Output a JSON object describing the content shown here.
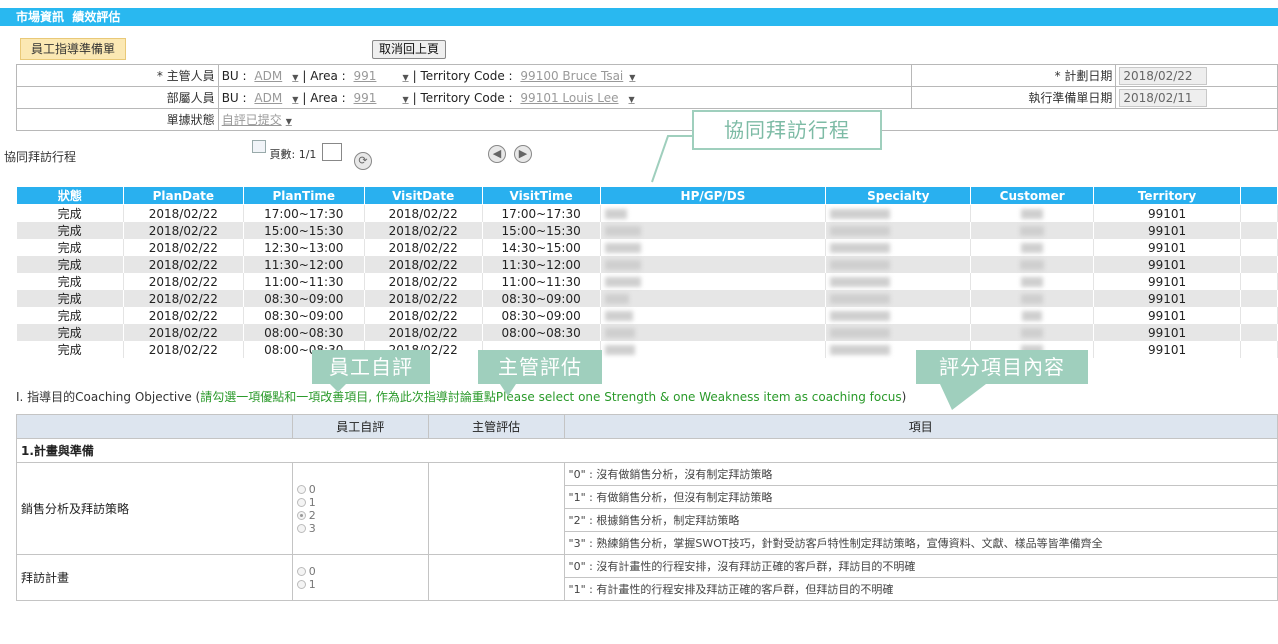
{
  "topbar": {
    "title": "市場資訊  績效評估"
  },
  "subtab": {
    "label": "員工指導準備單"
  },
  "back_button": {
    "label": "取消回上頁"
  },
  "form": {
    "rows": [
      {
        "label": "* 主管人員",
        "bu": "ADM",
        "area": "991",
        "territory": "99100 Bruce Tsai",
        "date_label": "* 計劃日期",
        "date": "2018/02/22"
      },
      {
        "label": "部屬人員",
        "bu": "ADM",
        "area": "991",
        "territory": "99101 Louis Lee",
        "date_label": "執行準備單日期",
        "date": "2018/02/11"
      }
    ],
    "bu_label": "BU :",
    "area_label": "Area :",
    "territory_label": "Territory Code :",
    "status_label": "單據狀態",
    "status_value": "自評已提交"
  },
  "visits_section": {
    "title": "協同拜訪行程",
    "pager_label": "頁數: 1/1"
  },
  "visits_table": {
    "headers": [
      "狀態",
      "PlanDate",
      "PlanTime",
      "VisitDate",
      "VisitTime",
      "HP/GP/DS",
      "Specialty",
      "Customer",
      "Territory"
    ],
    "rows": [
      {
        "status": "完成",
        "plan_date": "2018/02/22",
        "plan_time": "17:00~17:30",
        "visit_date": "2018/02/22",
        "visit_time": "17:00~17:30",
        "territory": "99101"
      },
      {
        "status": "完成",
        "plan_date": "2018/02/22",
        "plan_time": "15:00~15:30",
        "visit_date": "2018/02/22",
        "visit_time": "15:00~15:30",
        "territory": "99101"
      },
      {
        "status": "完成",
        "plan_date": "2018/02/22",
        "plan_time": "12:30~13:00",
        "visit_date": "2018/02/22",
        "visit_time": "14:30~15:00",
        "territory": "99101"
      },
      {
        "status": "完成",
        "plan_date": "2018/02/22",
        "plan_time": "11:30~12:00",
        "visit_date": "2018/02/22",
        "visit_time": "11:30~12:00",
        "territory": "99101"
      },
      {
        "status": "完成",
        "plan_date": "2018/02/22",
        "plan_time": "11:00~11:30",
        "visit_date": "2018/02/22",
        "visit_time": "11:00~11:30",
        "territory": "99101"
      },
      {
        "status": "完成",
        "plan_date": "2018/02/22",
        "plan_time": "08:30~09:00",
        "visit_date": "2018/02/22",
        "visit_time": "08:30~09:00",
        "territory": "99101"
      },
      {
        "status": "完成",
        "plan_date": "2018/02/22",
        "plan_time": "08:30~09:00",
        "visit_date": "2018/02/22",
        "visit_time": "08:30~09:00",
        "territory": "99101"
      },
      {
        "status": "完成",
        "plan_date": "2018/02/22",
        "plan_time": "08:00~08:30",
        "visit_date": "2018/02/22",
        "visit_time": "08:00~08:30",
        "territory": "99101"
      },
      {
        "status": "完成",
        "plan_date": "2018/02/22",
        "plan_time": "08:00~08:30",
        "visit_date": "2018/02/22",
        "visit_time": "",
        "territory": "99101"
      }
    ]
  },
  "objective": {
    "prefix": "I. 指導目的Coaching Objective (",
    "highlight": "請勾選一項優點和一項改善項目, 作為此次指導討論重點Please select one Strength & one Weakness item as coaching focus",
    "suffix": ")"
  },
  "score_table": {
    "headers": {
      "self": "員工自評",
      "manager": "主管評估",
      "item": "項目"
    },
    "category": "1.計畫與準備",
    "groups": [
      {
        "name": "銷售分析及拜訪策略",
        "options": [
          "0",
          "1",
          "2",
          "3"
        ],
        "selected": "2",
        "items": [
          "\"0\" : 沒有做銷售分析，沒有制定拜訪策略",
          "\"1\" : 有做銷售分析，但沒有制定拜訪策略",
          "\"2\" : 根據銷售分析，制定拜訪策略",
          "\"3\" : 熟練銷售分析，掌握SWOT技巧，針對受訪客戶特性制定拜訪策略，宣傳資料、文獻、樣品等皆準備齊全"
        ]
      },
      {
        "name": "拜訪計畫",
        "options": [
          "0",
          "1"
        ],
        "selected": "",
        "items": [
          "\"0\" : 沒有計畫性的行程安排，沒有拜訪正確的客戶群，拜訪目的不明確",
          "\"1\" : 有計畫性的行程安排及拜訪正確的客戶群，但拜訪目的不明確"
        ]
      }
    ]
  },
  "callouts": {
    "visits": "協同拜訪行程",
    "self": "員工自評",
    "manager": "主管評估",
    "items": "評分項目內容"
  }
}
